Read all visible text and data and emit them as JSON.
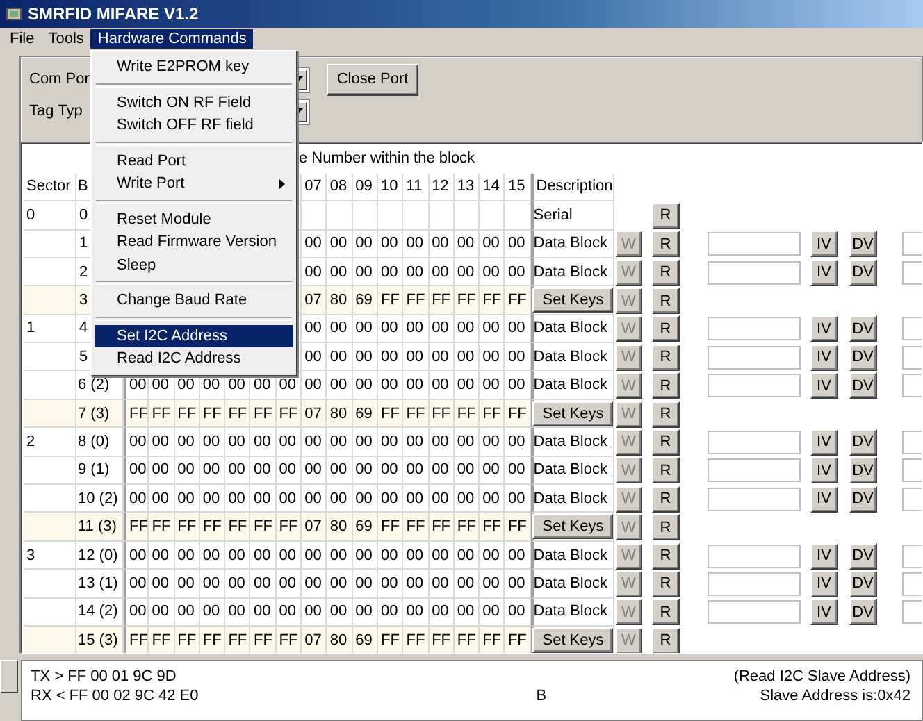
{
  "window": {
    "title": "SMRFID MIFARE V1.2"
  },
  "menubar": [
    {
      "label": "File",
      "selected": false
    },
    {
      "label": "Tools",
      "selected": false
    },
    {
      "label": "Hardware Commands",
      "selected": true
    }
  ],
  "menu": [
    {
      "kind": "item",
      "label": "Write E2PROM key",
      "selected": false
    },
    {
      "kind": "separator"
    },
    {
      "kind": "item",
      "label": "Switch ON RF Field",
      "selected": false
    },
    {
      "kind": "item",
      "label": "Switch OFF RF field",
      "selected": false
    },
    {
      "kind": "separator"
    },
    {
      "kind": "item",
      "label": "Read Port",
      "selected": false
    },
    {
      "kind": "submenu",
      "label": "Write Port",
      "selected": false
    },
    {
      "kind": "separator"
    },
    {
      "kind": "item",
      "label": "Reset Module",
      "selected": false
    },
    {
      "kind": "item",
      "label": "Read Firmware Version",
      "selected": false
    },
    {
      "kind": "item",
      "label": "Sleep",
      "selected": false
    },
    {
      "kind": "separator"
    },
    {
      "kind": "item",
      "label": "Change Baud Rate",
      "selected": false
    },
    {
      "kind": "separator"
    },
    {
      "kind": "item",
      "label": "Set I2C Address",
      "selected": true
    },
    {
      "kind": "item",
      "label": "Read I2C Address",
      "selected": false
    }
  ],
  "port": {
    "com_label": "Com Por",
    "tag_label": "Tag Typ",
    "close_button": "Close Port"
  },
  "table": {
    "caption": "e Number within the block",
    "header": {
      "sector": "Sector",
      "block": "B",
      "bytes": [
        "07",
        "08",
        "09",
        "10",
        "11",
        "12",
        "13",
        "14",
        "15"
      ],
      "description": "Description"
    },
    "rows": [
      {
        "kind": "serial",
        "sector": "0",
        "block": "0",
        "description": "Serial",
        "read": "R"
      },
      {
        "kind": "data",
        "block": "1",
        "bytes": [
          "00",
          "00",
          "00",
          "00",
          "00",
          "00",
          "00",
          "00",
          "00"
        ],
        "description": "Data Block",
        "write": "W",
        "write_disabled": true,
        "read": "R",
        "inc": "IV",
        "dec": "DV"
      },
      {
        "kind": "data",
        "block": "2",
        "bytes": [
          "00",
          "00",
          "00",
          "00",
          "00",
          "00",
          "00",
          "00",
          "00"
        ],
        "description": "Data Block",
        "write": "W",
        "write_disabled": true,
        "read": "R",
        "inc": "IV",
        "dec": "DV"
      },
      {
        "kind": "trailer",
        "block": "3",
        "bytes": [
          "07",
          "80",
          "69",
          "FF",
          "FF",
          "FF",
          "FF",
          "FF",
          "FF"
        ],
        "description": "Set Keys",
        "write": "W",
        "write_disabled": true,
        "read": "R"
      },
      {
        "kind": "data",
        "sector": "1",
        "block": "4",
        "bytes": [
          "00",
          "00",
          "00",
          "00",
          "00",
          "00",
          "00",
          "00",
          "00"
        ],
        "description": "Data Block",
        "write": "W",
        "write_disabled": true,
        "read": "R",
        "inc": "IV",
        "dec": "DV"
      },
      {
        "kind": "data",
        "block": "5",
        "bytes": [
          "00",
          "00",
          "00",
          "00",
          "00",
          "00",
          "00",
          "00",
          "00"
        ],
        "description": "Data Block",
        "write": "W",
        "write_disabled": true,
        "read": "R",
        "inc": "IV",
        "dec": "DV"
      },
      {
        "kind": "data",
        "block": "6 (2)",
        "bytes": [
          "00",
          "00",
          "00",
          "00",
          "00",
          "00",
          "00",
          "00",
          "00",
          "00",
          "00",
          "00",
          "00",
          "00",
          "00",
          "00"
        ],
        "description": "Data Block",
        "write": "W",
        "write_disabled": true,
        "read": "R",
        "inc": "IV",
        "dec": "DV"
      },
      {
        "kind": "trailer",
        "block": "7 (3)",
        "bytes": [
          "FF",
          "FF",
          "FF",
          "FF",
          "FF",
          "FF",
          "FF",
          "07",
          "80",
          "69",
          "FF",
          "FF",
          "FF",
          "FF",
          "FF",
          "FF"
        ],
        "description": "Set Keys",
        "write": "W",
        "write_disabled": true,
        "read": "R"
      },
      {
        "kind": "data",
        "sector": "2",
        "block": "8 (0)",
        "bytes": [
          "00",
          "00",
          "00",
          "00",
          "00",
          "00",
          "00",
          "00",
          "00",
          "00",
          "00",
          "00",
          "00",
          "00",
          "00",
          "00"
        ],
        "description": "Data Block",
        "write": "W",
        "write_disabled": true,
        "read": "R",
        "inc": "IV",
        "dec": "DV"
      },
      {
        "kind": "data",
        "block": "9 (1)",
        "bytes": [
          "00",
          "00",
          "00",
          "00",
          "00",
          "00",
          "00",
          "00",
          "00",
          "00",
          "00",
          "00",
          "00",
          "00",
          "00",
          "00"
        ],
        "description": "Data Block",
        "write": "W",
        "write_disabled": true,
        "read": "R",
        "inc": "IV",
        "dec": "DV"
      },
      {
        "kind": "data",
        "block": "10 (2)",
        "bytes": [
          "00",
          "00",
          "00",
          "00",
          "00",
          "00",
          "00",
          "00",
          "00",
          "00",
          "00",
          "00",
          "00",
          "00",
          "00",
          "00"
        ],
        "description": "Data Block",
        "write": "W",
        "write_disabled": true,
        "read": "R",
        "inc": "IV",
        "dec": "DV"
      },
      {
        "kind": "trailer",
        "block": "11 (3)",
        "bytes": [
          "FF",
          "FF",
          "FF",
          "FF",
          "FF",
          "FF",
          "FF",
          "07",
          "80",
          "69",
          "FF",
          "FF",
          "FF",
          "FF",
          "FF",
          "FF"
        ],
        "description": "Set Keys",
        "write": "W",
        "write_disabled": true,
        "read": "R"
      },
      {
        "kind": "data",
        "sector": "3",
        "block": "12 (0)",
        "bytes": [
          "00",
          "00",
          "00",
          "00",
          "00",
          "00",
          "00",
          "00",
          "00",
          "00",
          "00",
          "00",
          "00",
          "00",
          "00",
          "00"
        ],
        "description": "Data Block",
        "write": "W",
        "write_disabled": true,
        "read": "R",
        "inc": "IV",
        "dec": "DV"
      },
      {
        "kind": "data",
        "block": "13 (1)",
        "bytes": [
          "00",
          "00",
          "00",
          "00",
          "00",
          "00",
          "00",
          "00",
          "00",
          "00",
          "00",
          "00",
          "00",
          "00",
          "00",
          "00"
        ],
        "description": "Data Block",
        "write": "W",
        "write_disabled": true,
        "read": "R",
        "inc": "IV",
        "dec": "DV"
      },
      {
        "kind": "data",
        "block": "14 (2)",
        "bytes": [
          "00",
          "00",
          "00",
          "00",
          "00",
          "00",
          "00",
          "00",
          "00",
          "00",
          "00",
          "00",
          "00",
          "00",
          "00",
          "00"
        ],
        "description": "Data Block",
        "write": "W",
        "write_disabled": true,
        "read": "R",
        "inc": "IV",
        "dec": "DV"
      },
      {
        "kind": "trailer",
        "block": "15 (3)",
        "bytes": [
          "FF",
          "FF",
          "FF",
          "FF",
          "FF",
          "FF",
          "FF",
          "07",
          "80",
          "69",
          "FF",
          "FF",
          "FF",
          "FF",
          "FF",
          "FF"
        ],
        "description": "Set Keys",
        "write": "W",
        "write_disabled": true,
        "read": "R"
      }
    ]
  },
  "log": {
    "lines": [
      "TX > FF 00 01 9C 9D",
      "RX < FF 00 02 9C 42 E0"
    ],
    "center": "B",
    "right_lines": [
      "(Read I2C Slave Address)",
      "Slave Address is:0x42"
    ]
  }
}
